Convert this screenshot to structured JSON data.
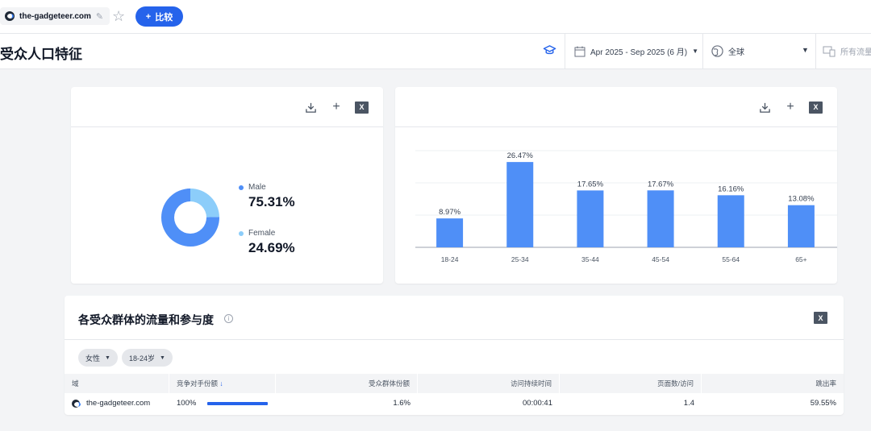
{
  "topbar": {
    "site": "the-gadgeteer.com",
    "compare_label": "比较"
  },
  "header": {
    "title": "受众人口特征",
    "date_range": "Apr 2025 - Sep 2025 (6 月)",
    "region": "全球",
    "traffic": "所有流量"
  },
  "gender_chart": {
    "chart_data": {
      "type": "pie",
      "categories": [
        "Male",
        "Female"
      ],
      "values": [
        75.31,
        24.69
      ],
      "value_labels": [
        "75.31%",
        "24.69%"
      ],
      "colors": [
        "#4f8ff7",
        "#8ccdfa"
      ]
    }
  },
  "age_chart": {
    "chart_data": {
      "type": "bar",
      "categories": [
        "18-24",
        "25-34",
        "35-44",
        "45-54",
        "55-64",
        "65+"
      ],
      "values": [
        8.97,
        26.47,
        17.65,
        17.67,
        16.16,
        13.08
      ],
      "value_labels": [
        "8.97%",
        "26.47%",
        "17.65%",
        "17.67%",
        "16.16%",
        "13.08%"
      ],
      "ylim": [
        0,
        30
      ],
      "grid": true,
      "color": "#4f8ff7"
    }
  },
  "engagement": {
    "title": "各受众群体的流量和参与度",
    "filters": [
      "女性",
      "18-24岁"
    ],
    "columns": [
      "域",
      "竞争对手份额",
      "受众群体份额",
      "访问持续时间",
      "页面数/访问",
      "跳出率"
    ],
    "row": {
      "domain": "the-gadgeteer.com",
      "competitor_share": "100%",
      "competitor_share_fraction": 1.0,
      "audience_share": "1.6%",
      "visit_duration": "00:00:41",
      "pages_per_visit": "1.4",
      "bounce_rate": "59.55%"
    }
  },
  "colors": {
    "accent": "#2563eb",
    "bar": "#4f8ff7",
    "female": "#8ccdfa"
  }
}
